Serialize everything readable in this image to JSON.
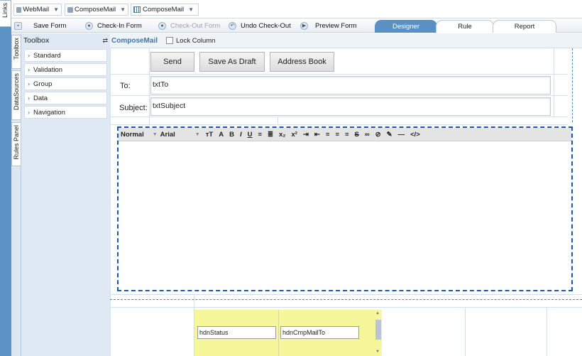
{
  "rails": {
    "links": "Links",
    "toolbox": "Toolbox",
    "datasources": "DataSources",
    "rules": "Rules Panel"
  },
  "breadcrumbs": [
    "WebMail",
    "ComposeMail",
    "ComposeMail"
  ],
  "toolbar": {
    "save": "Save Form",
    "checkin": "Check-In Form",
    "checkout": "Check-Out Form",
    "undo": "Undo Check-Out",
    "preview": "Preview Form"
  },
  "tabs": [
    "Designer",
    "Rule",
    "Report"
  ],
  "toolbox": {
    "title": "Toolbox",
    "items": [
      "Standard",
      "Validation",
      "Group",
      "Data",
      "Navigation"
    ]
  },
  "canvas": {
    "form_name": "ComposeMail",
    "lock_label": "Lock Column"
  },
  "form": {
    "send": "Send",
    "draft": "Save As Draft",
    "address": "Address Book",
    "to_label": "To:",
    "to_value": "txtTo",
    "subject_label": "Subject:",
    "subject_value": "txtSubject"
  },
  "editor": {
    "style": "Normal",
    "font": "Arial"
  },
  "hidden": {
    "status": "hdnStatus",
    "mail_to": "hdnCmpMailTo"
  },
  "colors": {
    "accent": "#5a90c4",
    "hidden_bg": "#f5f79a"
  }
}
